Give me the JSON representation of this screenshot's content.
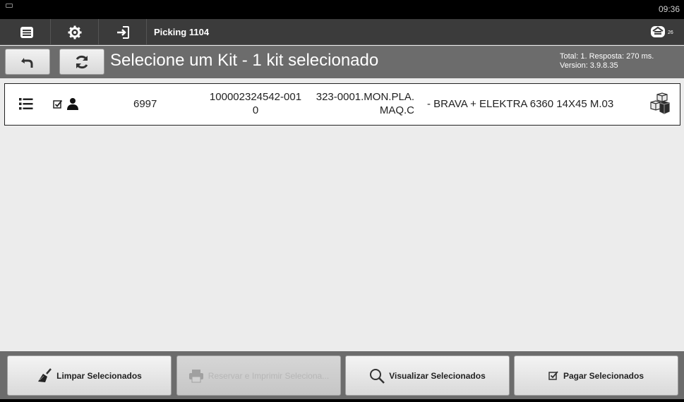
{
  "statusbar": {
    "time": "09:36"
  },
  "actionbar": {
    "title": "Picking 1104",
    "icons": [
      "list-icon",
      "gear-icon",
      "sign-in-icon"
    ],
    "notification_count": "26"
  },
  "header": {
    "title": "Selecione um Kit - 1 kit selecionado",
    "meta_line1": "Total: 1. Resposta: 270 ms.",
    "meta_line2": "Version: 3.9.8.35"
  },
  "rows": [
    {
      "code": "6997",
      "ref_line1": "100002324542-001",
      "ref_line2": "0",
      "product_line1": "323-0001.MON.PLA.",
      "product_line2": "MAQ.C",
      "description": "- BRAVA + ELEKTRA 6360 14X45 M.03"
    }
  ],
  "footer": {
    "clear_label": "Limpar Selecionados",
    "reserve_label": "Reservar e Imprimir Seleciona...",
    "view_label": "Visualizar Selecionados",
    "pay_label": "Pagar Selecionados"
  }
}
